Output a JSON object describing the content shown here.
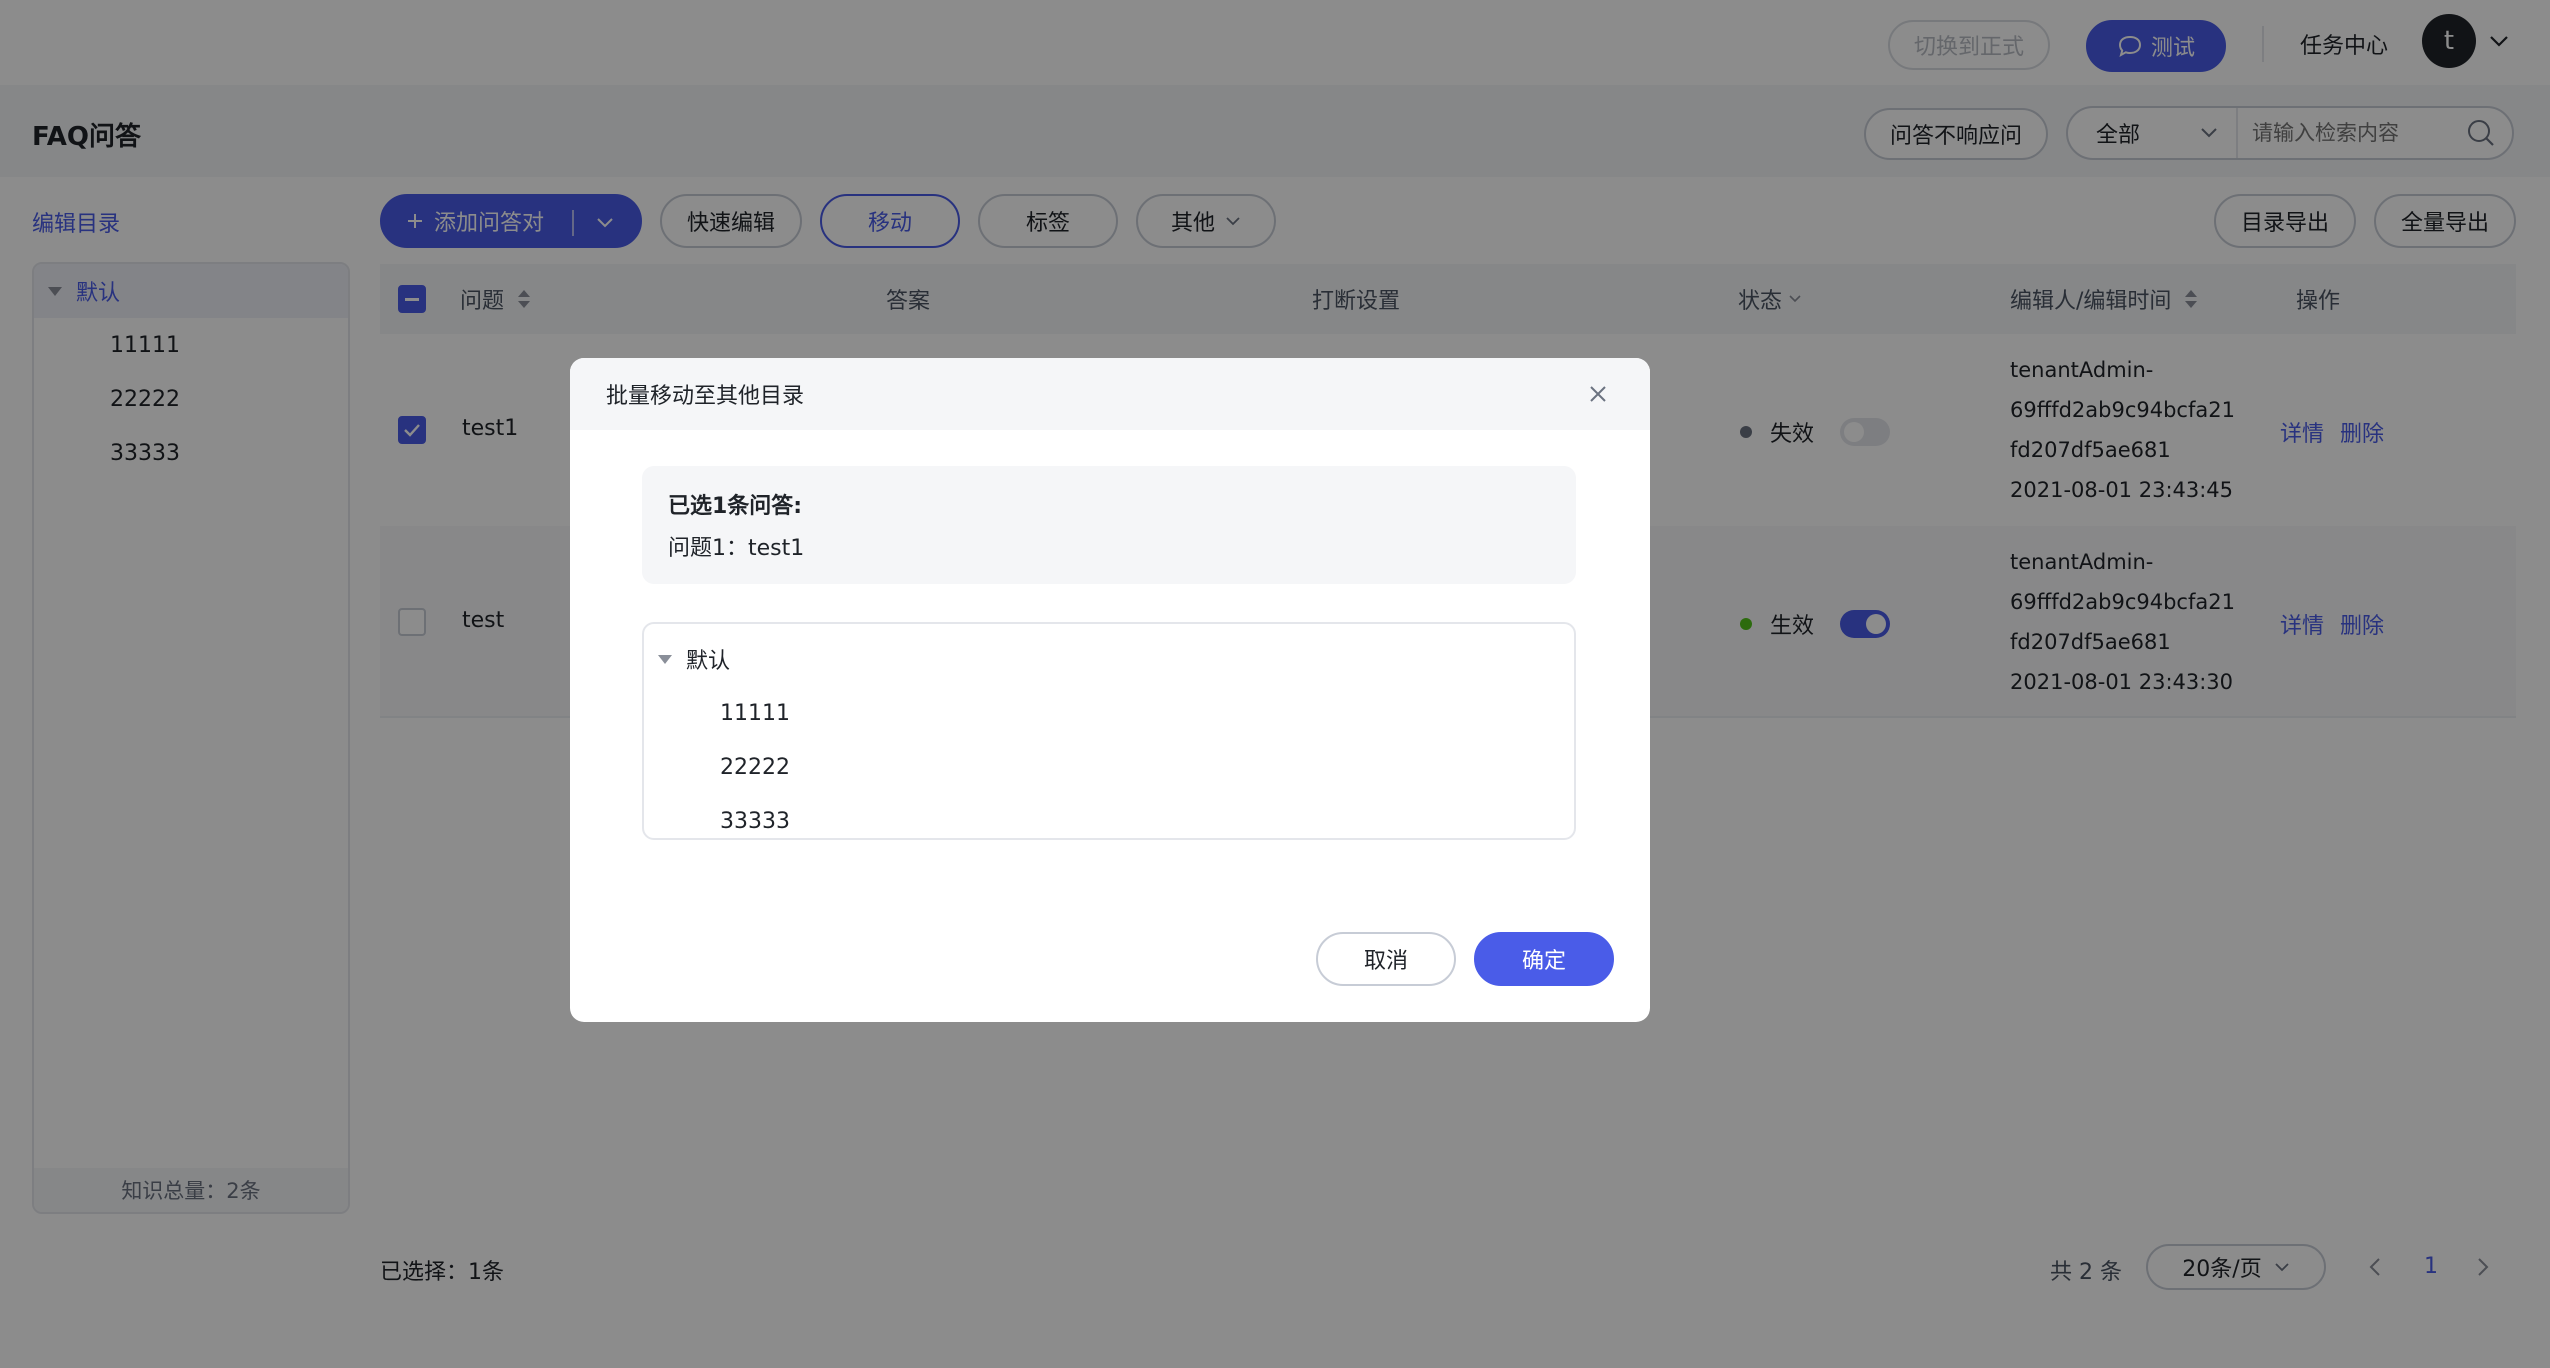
{
  "topbar": {
    "switch_formal": "切换到正式",
    "test": "测试",
    "task_center": "任务中心",
    "avatar_letter": "t"
  },
  "header": {
    "title": "FAQ问答",
    "no_response": "问答不响应问",
    "filter_value": "全部",
    "search_placeholder": "请输入检索内容"
  },
  "sidebar": {
    "title": "编辑目录",
    "root": "默认",
    "children": [
      "11111",
      "22222",
      "33333"
    ],
    "footer": "知识总量：2条"
  },
  "toolbar": {
    "add_pair": "添加问答对",
    "quick_edit": "快速编辑",
    "move": "移动",
    "tag": "标签",
    "other": "其他",
    "export_dir": "目录导出",
    "export_all": "全量导出"
  },
  "table": {
    "headers": {
      "question": "问题",
      "answer": "答案",
      "interrupt": "打断设置",
      "status": "状态",
      "editor": "编辑人/编辑时间",
      "action": "操作"
    },
    "rows": [
      {
        "question": "test1",
        "status": "失效",
        "editor_line1": "tenantAdmin-",
        "editor_line2": "69fffd2ab9c94bcfa21",
        "editor_line3": "fd207df5ae681",
        "time": "2021-08-01 23:43:45",
        "detail": "详情",
        "delete": "删除"
      },
      {
        "question": "test",
        "status": "生效",
        "editor_line1": "tenantAdmin-",
        "editor_line2": "69fffd2ab9c94bcfa21",
        "editor_line3": "fd207df5ae681",
        "time": "2021-08-01 23:43:30",
        "detail": "详情",
        "delete": "删除"
      }
    ]
  },
  "footer": {
    "selected": "已选择：1条",
    "total": "共 2 条",
    "page_size": "20条/页",
    "current_page": "1"
  },
  "modal": {
    "title": "批量移动至其他目录",
    "summary_title": "已选1条问答:",
    "summary_item": "问题1：test1",
    "tree_root": "默认",
    "tree_children": [
      "11111",
      "22222",
      "33333"
    ],
    "cancel": "取消",
    "confirm": "确定"
  },
  "colors": {
    "primary": "#4a5ce8",
    "inactive_dot": "#6b7280",
    "active_dot": "#52c41a"
  }
}
